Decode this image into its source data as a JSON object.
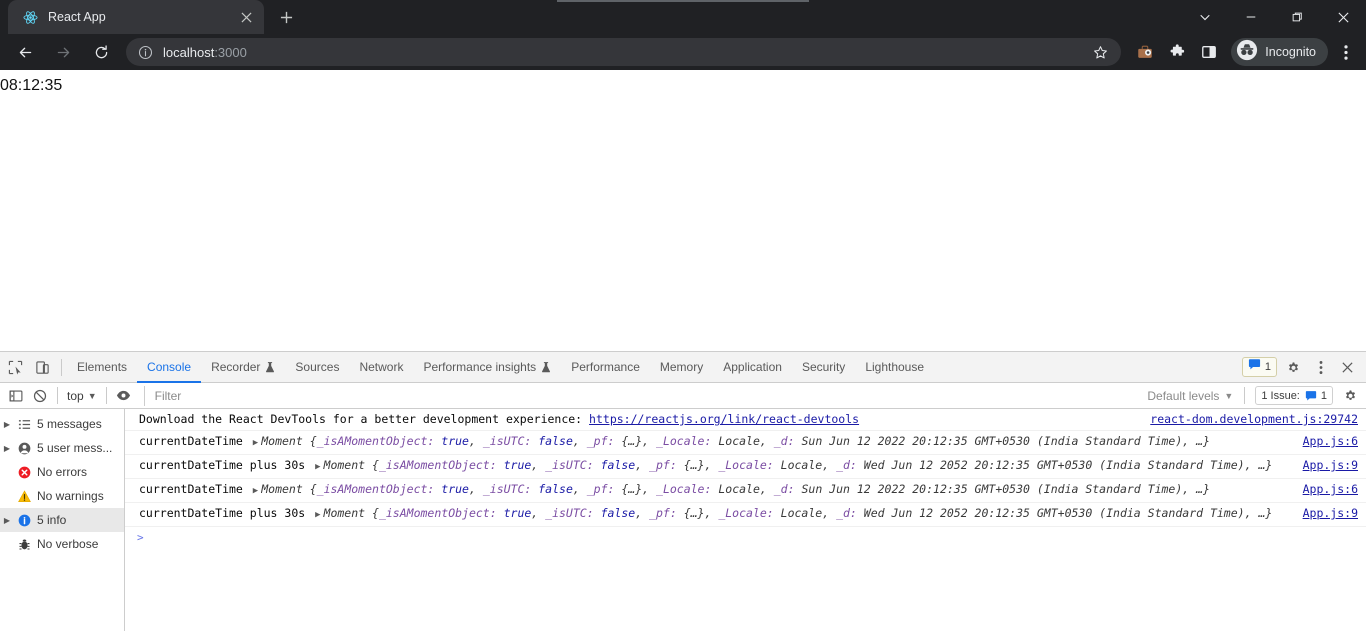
{
  "browser": {
    "tab": {
      "title": "React App",
      "favicon": "react-logo-icon",
      "close": "close-icon"
    },
    "new_tab_label": "+",
    "window_controls": {
      "minimize": "minimize-icon",
      "maximize": "maximize-icon",
      "close": "close-icon",
      "tab_search": "chevron-down-icon"
    },
    "nav": {
      "back": "back-arrow-icon",
      "forward": "forward-arrow-icon",
      "reload": "reload-icon"
    },
    "omnibox": {
      "info_icon": "info-circle-icon",
      "url_host": "localhost",
      "url_port": ":3000",
      "full_url": "localhost:3000",
      "star_icon": "star-icon"
    },
    "toolbar_icons": [
      "briefcase-icon",
      "extensions-puzzle-icon",
      "side-panel-icon"
    ],
    "incognito": {
      "label": "Incognito",
      "icon": "incognito-icon"
    },
    "menu": "kebab-menu-icon",
    "colors": {
      "chrome_bg": "#202124",
      "tab_active_bg": "#35363a",
      "omnibox_bg": "#35363a"
    }
  },
  "page": {
    "clock": "08:12:35"
  },
  "devtools": {
    "tool_buttons": {
      "inspect": "inspect-element-icon",
      "device": "device-toolbar-icon"
    },
    "tabs": [
      {
        "label": "Elements",
        "active": false,
        "flask": false
      },
      {
        "label": "Console",
        "active": true,
        "flask": false
      },
      {
        "label": "Recorder",
        "active": false,
        "flask": true
      },
      {
        "label": "Sources",
        "active": false,
        "flask": false
      },
      {
        "label": "Network",
        "active": false,
        "flask": false
      },
      {
        "label": "Performance insights",
        "active": false,
        "flask": true
      },
      {
        "label": "Performance",
        "active": false,
        "flask": false
      },
      {
        "label": "Memory",
        "active": false,
        "flask": false
      },
      {
        "label": "Application",
        "active": false,
        "flask": false
      },
      {
        "label": "Security",
        "active": false,
        "flask": false
      },
      {
        "label": "Lighthouse",
        "active": false,
        "flask": false
      }
    ],
    "tabbar_right": {
      "message_badge_count": "1",
      "message_badge_icon": "message-bubble-icon",
      "settings": "gear-icon",
      "more": "kebab-menu-icon",
      "close": "close-icon"
    },
    "filterbar": {
      "sidebar_toggle": "console-sidebar-toggle-icon",
      "clear_console": "clear-console-icon",
      "context": "top",
      "context_caret": "▼",
      "live_expression": "eye-icon",
      "filter_placeholder": "Filter",
      "filter_value": "",
      "levels_label": "Default levels",
      "levels_caret": "▼",
      "issues_label": "1 Issue:",
      "issues_count": "1",
      "issues_icon": "message-bubble-icon",
      "settings": "gear-icon"
    },
    "sidebar": [
      {
        "label": "5 messages",
        "icon": "list-icon",
        "arrow": true,
        "selected": false
      },
      {
        "label": "5 user mess...",
        "icon": "user-icon",
        "arrow": true,
        "selected": false
      },
      {
        "label": "No errors",
        "icon": "error-icon",
        "arrow": false,
        "selected": false
      },
      {
        "label": "No warnings",
        "icon": "warning-icon",
        "arrow": false,
        "selected": false
      },
      {
        "label": "5 info",
        "icon": "info-icon",
        "arrow": true,
        "selected": true
      },
      {
        "label": "No verbose",
        "icon": "bug-icon",
        "arrow": false,
        "selected": false
      }
    ],
    "log_rows": [
      {
        "type": "link-message",
        "text": "Download the React DevTools for a better development experience: ",
        "link": "https://reactjs.org/link/react-devtools",
        "source": "react-dom.development.js:29742"
      },
      {
        "type": "object",
        "label": "currentDateTime",
        "disclosure": "▶",
        "ctor": "Moment",
        "preview": "{_isAMomentObject: true, _isUTC: false, _pf: {…}, _Locale: Locale, _d: Sun Jun 12 2022 20:12:35 GMT+0530 (India Standard Time), …}",
        "date": "Sun Jun 12 2022 20:12:35 GMT+0530 (India Standard Time)",
        "source": "App.js:6"
      },
      {
        "type": "object",
        "label": "currentDateTime plus 30s",
        "disclosure": "▶",
        "ctor": "Moment",
        "preview": "{_isAMomentObject: true, _isUTC: false, _pf: {…}, _Locale: Locale, _d: Wed Jun 12 2052 20:12:35 GMT+0530 (India Standard Time), …}",
        "date": "Wed Jun 12 2052 20:12:35 GMT+0530 (India Standard Time)",
        "source": "App.js:9"
      },
      {
        "type": "object",
        "label": "currentDateTime",
        "disclosure": "▶",
        "ctor": "Moment",
        "preview": "{_isAMomentObject: true, _isUTC: false, _pf: {…}, _Locale: Locale, _d: Sun Jun 12 2022 20:12:35 GMT+0530 (India Standard Time), …}",
        "date": "Sun Jun 12 2022 20:12:35 GMT+0530 (India Standard Time)",
        "source": "App.js:6"
      },
      {
        "type": "object",
        "label": "currentDateTime plus 30s",
        "disclosure": "▶",
        "ctor": "Moment",
        "preview": "{_isAMomentObject: true, _isUTC: false, _pf: {…}, _Locale: Locale, _d: Wed Jun 12 2052 20:12:35 GMT+0530 (India Standard Time), …}",
        "date": "Wed Jun 12 2052 20:12:35 GMT+0530 (India Standard Time)",
        "source": "App.js:9"
      }
    ],
    "prompt_caret": ">",
    "object_props": {
      "p1": "_isAMomentObject:",
      "v1": "true",
      "p2": "_isUTC:",
      "v2": "false",
      "p3": "_pf:",
      "v3": "{…}",
      "p4": "_Locale:",
      "v4": "Locale",
      "p5": "_d:",
      "open": "{",
      "close": ", …}",
      "comma": ", "
    }
  }
}
